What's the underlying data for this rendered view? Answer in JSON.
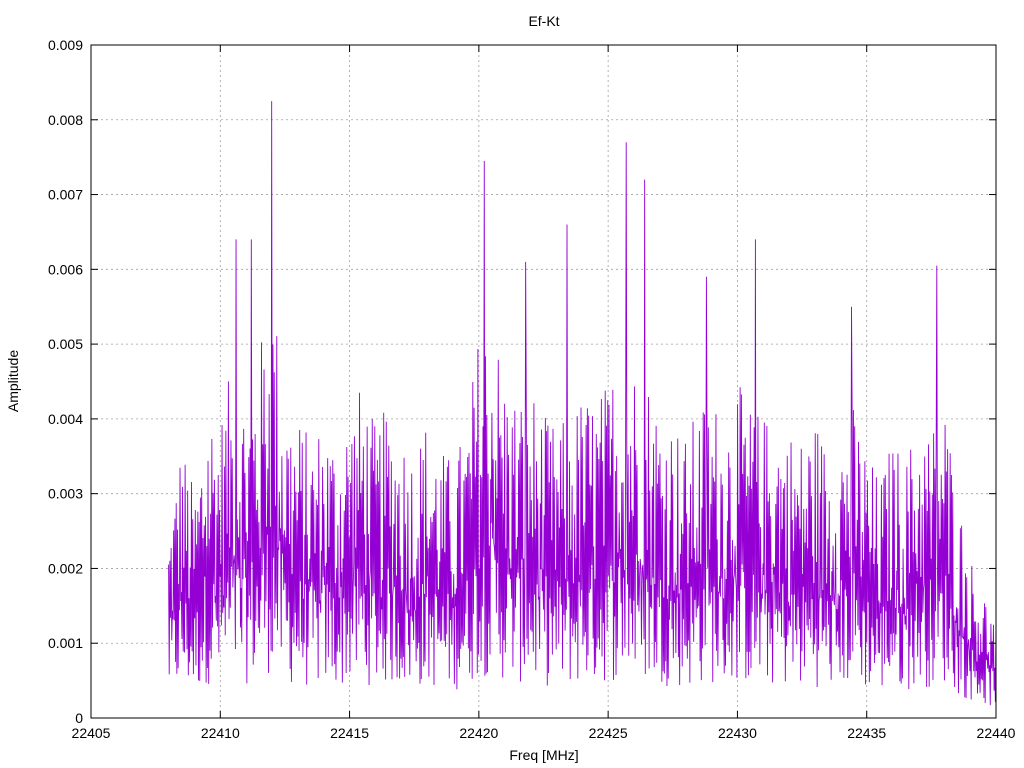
{
  "chart_data": {
    "type": "line",
    "title": "Ef-Kt",
    "xlabel": "Freq [MHz]",
    "ylabel": "Amplitude",
    "xlim": [
      22405,
      22440
    ],
    "ylim": [
      0,
      0.009
    ],
    "xticks": [
      22405,
      22410,
      22415,
      22420,
      22425,
      22430,
      22435,
      22440
    ],
    "yticks": [
      0,
      0.001,
      0.002,
      0.003,
      0.004,
      0.005,
      0.006,
      0.007,
      0.008,
      0.009
    ],
    "xtick_labels": [
      "22405",
      "22410",
      "22415",
      "22420",
      "22425",
      "22430",
      "22435",
      "22440"
    ],
    "ytick_labels": [
      "0",
      "0.001",
      "0.002",
      "0.003",
      "0.004",
      "0.005",
      "0.006",
      "0.007",
      "0.008",
      "0.009"
    ],
    "grid": true,
    "series_color": "#9400d3",
    "series": [
      {
        "x": [
          22408.0,
          22408.5,
          22409.0,
          22409.5,
          22410.0,
          22410.5,
          22411.0,
          22411.5,
          22412.0,
          22412.5,
          22413.0,
          22413.5,
          22414.0,
          22414.5,
          22415.0,
          22415.5,
          22416.0,
          22416.5,
          22417.0,
          22417.5,
          22418.0,
          22418.5,
          22419.0,
          22419.5,
          22420.0,
          22420.5,
          22421.0,
          22421.5,
          22422.0,
          22422.5,
          22423.0,
          22423.5,
          22424.0,
          22424.5,
          22425.0,
          22425.5,
          22426.0,
          22426.5,
          22427.0,
          22427.5,
          22428.0,
          22428.5,
          22429.0,
          22429.5,
          22430.0,
          22430.5,
          22431.0,
          22431.5,
          22432.0,
          22432.5,
          22433.0,
          22433.5,
          22434.0,
          22434.5,
          22435.0,
          22435.5,
          22436.0,
          22436.5,
          22437.0,
          22437.5,
          22438.0,
          22438.5,
          22439.0,
          22439.5,
          22440.0
        ],
        "values": [
          0.0018,
          0.0026,
          0.0021,
          0.003,
          0.0028,
          0.0033,
          0.003,
          0.0034,
          0.0041,
          0.003,
          0.0028,
          0.0026,
          0.0028,
          0.0026,
          0.0029,
          0.0031,
          0.0027,
          0.0029,
          0.0027,
          0.0025,
          0.0028,
          0.0025,
          0.0024,
          0.0027,
          0.0036,
          0.0038,
          0.0032,
          0.003,
          0.0031,
          0.0028,
          0.0027,
          0.0028,
          0.003,
          0.003,
          0.0031,
          0.0035,
          0.0033,
          0.0032,
          0.0029,
          0.0028,
          0.0026,
          0.0029,
          0.003,
          0.0028,
          0.0031,
          0.0029,
          0.0028,
          0.0028,
          0.0027,
          0.0026,
          0.0028,
          0.0025,
          0.0027,
          0.0029,
          0.0025,
          0.0022,
          0.0026,
          0.0024,
          0.0028,
          0.0027,
          0.003,
          0.0021,
          0.0015,
          0.0012,
          0.0009
        ],
        "peaks": [
          {
            "x": 22412.0,
            "value": 0.00825
          },
          {
            "x": 22411.2,
            "value": 0.0064
          },
          {
            "x": 22410.6,
            "value": 0.0064
          },
          {
            "x": 22420.2,
            "value": 0.00745
          },
          {
            "x": 22425.7,
            "value": 0.0077
          },
          {
            "x": 22426.4,
            "value": 0.0072
          },
          {
            "x": 22423.4,
            "value": 0.0066
          },
          {
            "x": 22430.7,
            "value": 0.0064
          },
          {
            "x": 22437.7,
            "value": 0.00605
          },
          {
            "x": 22421.8,
            "value": 0.0061
          },
          {
            "x": 22428.8,
            "value": 0.0059
          },
          {
            "x": 22434.4,
            "value": 0.0055
          }
        ]
      }
    ]
  }
}
